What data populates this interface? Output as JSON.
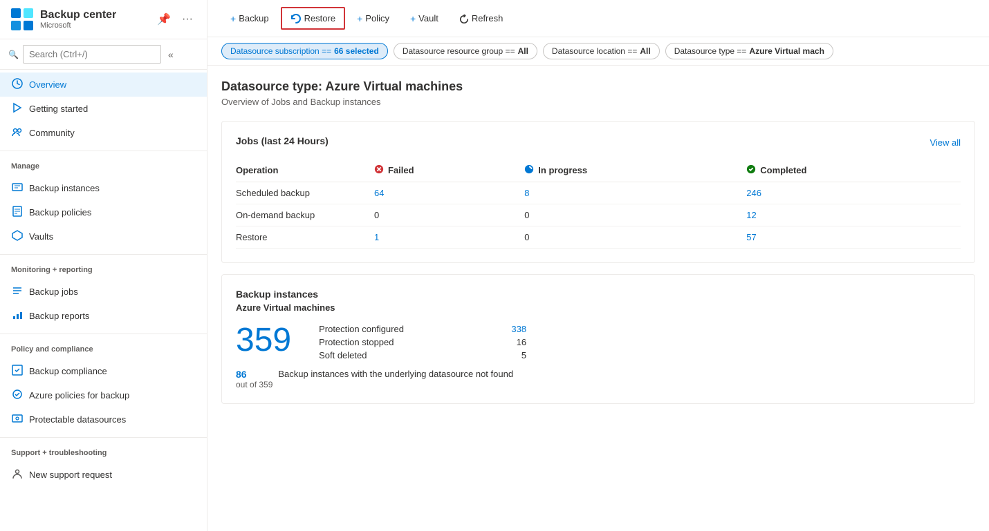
{
  "sidebar": {
    "app_title": "Backup center",
    "app_subtitle": "Microsoft",
    "search_placeholder": "Search (Ctrl+/)",
    "nav_items": [
      {
        "id": "overview",
        "label": "Overview",
        "icon": "☁",
        "active": true,
        "section": null
      },
      {
        "id": "getting-started",
        "label": "Getting started",
        "icon": "🚀",
        "active": false,
        "section": null
      },
      {
        "id": "community",
        "label": "Community",
        "icon": "👥",
        "active": false,
        "section": null
      },
      {
        "id": "backup-instances",
        "label": "Backup instances",
        "icon": "🖥",
        "active": false,
        "section": "Manage"
      },
      {
        "id": "backup-policies",
        "label": "Backup policies",
        "icon": "📋",
        "active": false,
        "section": null
      },
      {
        "id": "vaults",
        "label": "Vaults",
        "icon": "☁",
        "active": false,
        "section": null
      },
      {
        "id": "backup-jobs",
        "label": "Backup jobs",
        "icon": "≡",
        "active": false,
        "section": "Monitoring + reporting"
      },
      {
        "id": "backup-reports",
        "label": "Backup reports",
        "icon": "📊",
        "active": false,
        "section": null
      },
      {
        "id": "backup-compliance",
        "label": "Backup compliance",
        "icon": "🔲",
        "active": false,
        "section": "Policy and compliance"
      },
      {
        "id": "azure-policies",
        "label": "Azure policies for backup",
        "icon": "⚙",
        "active": false,
        "section": null
      },
      {
        "id": "protectable-datasources",
        "label": "Protectable datasources",
        "icon": "🖥",
        "active": false,
        "section": null
      },
      {
        "id": "new-support-request",
        "label": "New support request",
        "icon": "👤",
        "active": false,
        "section": "Support + troubleshooting"
      }
    ]
  },
  "toolbar": {
    "backup_label": "Backup",
    "restore_label": "Restore",
    "policy_label": "Policy",
    "vault_label": "Vault",
    "refresh_label": "Refresh"
  },
  "filters": [
    {
      "id": "subscription",
      "label": "Datasource subscription == ",
      "value": "66 selected",
      "active": true
    },
    {
      "id": "resource-group",
      "label": "Datasource resource group == ",
      "value": "All",
      "active": false
    },
    {
      "id": "location",
      "label": "Datasource location == ",
      "value": "All",
      "active": false
    },
    {
      "id": "type",
      "label": "Datasource type == ",
      "value": "Azure Virtual mach",
      "active": false
    }
  ],
  "page": {
    "title": "Datasource type: Azure Virtual machines",
    "subtitle": "Overview of Jobs and Backup instances"
  },
  "jobs_card": {
    "title": "Jobs (last 24 Hours)",
    "view_all_label": "View all",
    "columns": {
      "operation": "Operation",
      "failed": "Failed",
      "in_progress": "In progress",
      "completed": "Completed"
    },
    "rows": [
      {
        "operation": "Scheduled backup",
        "failed": "64",
        "in_progress": "8",
        "completed": "246"
      },
      {
        "operation": "On-demand backup",
        "failed": "0",
        "in_progress": "0",
        "completed": "12"
      },
      {
        "operation": "Restore",
        "failed": "1",
        "in_progress": "0",
        "completed": "57"
      }
    ]
  },
  "backup_instances_card": {
    "title": "Backup instances",
    "subtitle": "Azure Virtual machines",
    "total_count": "359",
    "details": [
      {
        "label": "Protection configured",
        "value": "338",
        "is_link": true
      },
      {
        "label": "Protection stopped",
        "value": "16",
        "is_link": false
      },
      {
        "label": "Soft deleted",
        "value": "5",
        "is_link": false
      }
    ],
    "footer_count": "86",
    "footer_sub": "out of 359",
    "footer_desc": "Backup instances with the underlying datasource not found"
  }
}
